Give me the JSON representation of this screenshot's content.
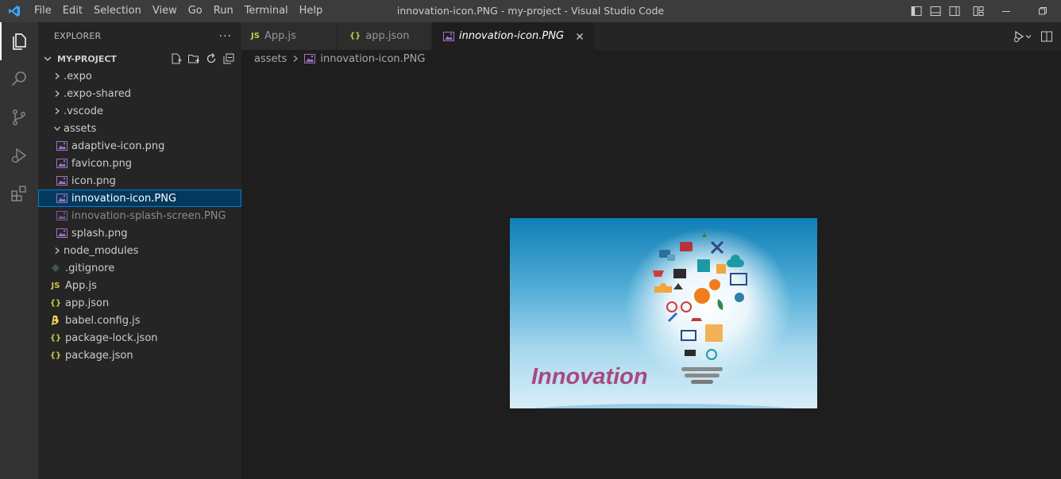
{
  "titlebar": {
    "menu": [
      "File",
      "Edit",
      "Selection",
      "View",
      "Go",
      "Run",
      "Terminal",
      "Help"
    ],
    "title": "innovation-icon.PNG - my-project - Visual Studio Code"
  },
  "sidebar": {
    "header": "EXPLORER",
    "more": "···",
    "project": "MY-PROJECT",
    "items": [
      {
        "label": ".expo",
        "type": "folder"
      },
      {
        "label": ".expo-shared",
        "type": "folder"
      },
      {
        "label": ".vscode",
        "type": "folder"
      },
      {
        "label": "assets",
        "type": "folder-open"
      },
      {
        "label": "adaptive-icon.png",
        "type": "image"
      },
      {
        "label": "favicon.png",
        "type": "image"
      },
      {
        "label": "icon.png",
        "type": "image"
      },
      {
        "label": "innovation-icon.PNG",
        "type": "image",
        "selected": true
      },
      {
        "label": "innovation-splash-screen.PNG",
        "type": "image",
        "dim": true
      },
      {
        "label": "splash.png",
        "type": "image"
      },
      {
        "label": "node_modules",
        "type": "folder"
      },
      {
        "label": ".gitignore",
        "type": "git"
      },
      {
        "label": "App.js",
        "type": "js"
      },
      {
        "label": "app.json",
        "type": "json"
      },
      {
        "label": "babel.config.js",
        "type": "babel"
      },
      {
        "label": "package-lock.json",
        "type": "json"
      },
      {
        "label": "package.json",
        "type": "json"
      }
    ]
  },
  "tabs": [
    {
      "label": "App.js",
      "icon": "JS"
    },
    {
      "label": "app.json",
      "icon": "{}"
    },
    {
      "label": "innovation-icon.PNG",
      "icon": "image",
      "active": true
    }
  ],
  "breadcrumb": {
    "folder": "assets",
    "file": "innovation-icon.PNG"
  },
  "preview": {
    "caption": "Innovation"
  },
  "colors": {
    "accent": "#007fd4",
    "js": "#cbcb41",
    "json": "#cbcb41",
    "image": "#a074c4",
    "caption": "#a9487e"
  }
}
